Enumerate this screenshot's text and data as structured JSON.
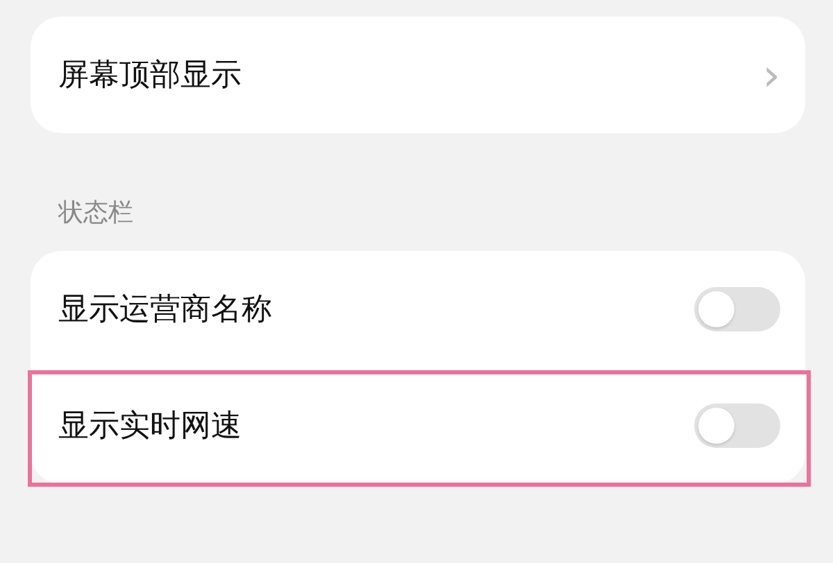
{
  "top_card": {
    "label": "屏幕顶部显示",
    "chevron": "›"
  },
  "section": {
    "title": "状态栏",
    "rows": [
      {
        "label": "显示运营商名称",
        "on": false,
        "highlighted": false
      },
      {
        "label": "显示实时网速",
        "on": false,
        "highlighted": true
      }
    ]
  }
}
